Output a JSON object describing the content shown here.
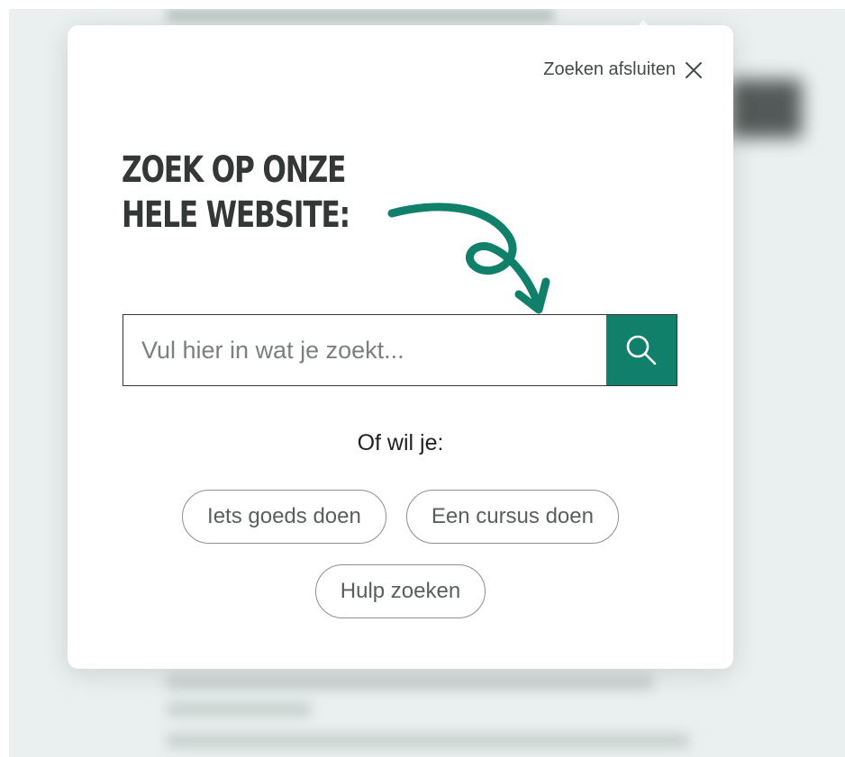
{
  "overlay": {
    "close_label": "Zoeken afsluiten",
    "heading_line1": "ZOEK OP ONZE",
    "heading_line2": "HELE WEBSITE:",
    "search": {
      "placeholder": "Vul hier in wat je zoekt...",
      "value": ""
    },
    "alternatives_label": "Of wil je:",
    "suggestions": [
      "Iets goeds doen",
      "Een cursus doen",
      "Hulp zoeken"
    ]
  },
  "icons": {
    "close": "close-icon",
    "search": "search-icon",
    "arrow": "curly-arrow-icon"
  },
  "colors": {
    "accent": "#10806a",
    "heading": "#333736",
    "backdrop": "#e9f0ef"
  }
}
